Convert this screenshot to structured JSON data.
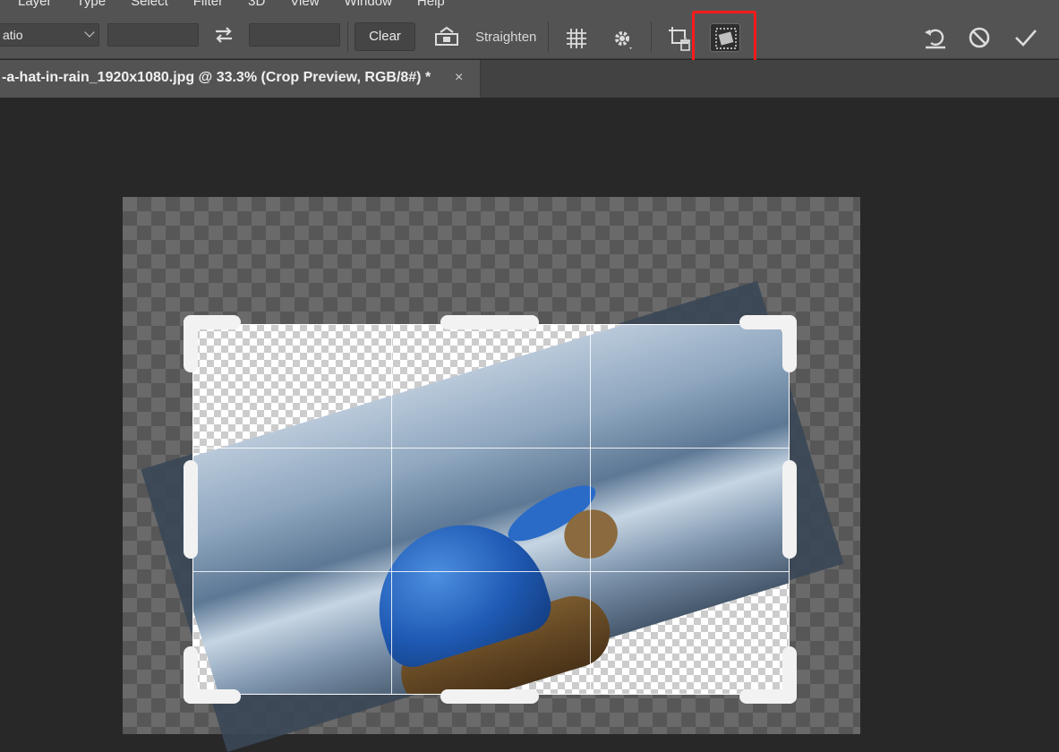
{
  "menubar": {
    "items": [
      "Layer",
      "Type",
      "Select",
      "Filter",
      "3D",
      "View",
      "Window",
      "Help"
    ]
  },
  "options_bar": {
    "ratio_select": "atio",
    "clear_label": "Clear",
    "straighten_label": "Straighten",
    "icons": {
      "swap": "swap-arrows-icon",
      "straighten": "straighten-level-icon",
      "overlay": "grid-overlay-icon",
      "settings": "gear-icon",
      "delete_cropped": "delete-cropped-pixels-icon",
      "content_aware": "content-aware-fill-icon",
      "reset": "reset-icon",
      "cancel": "cancel-icon",
      "commit": "checkmark-icon"
    },
    "highlight_color": "#ff1a1a"
  },
  "document_tab": {
    "title": "-a-hat-in-rain_1920x1080.jpg @ 33.3% (Crop Preview, RGB/8#) *",
    "close": "×"
  }
}
